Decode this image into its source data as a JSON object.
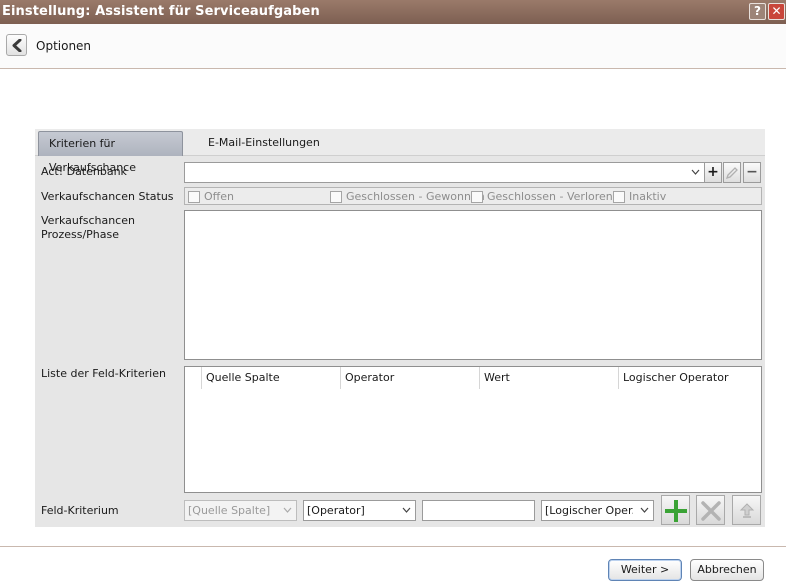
{
  "window": {
    "title": "Einstellung: Assistent für Serviceaufgaben",
    "help_label": "?",
    "close_label": "✕"
  },
  "options_bar": {
    "label": "Optionen"
  },
  "tabs": [
    {
      "label": "Kriterien für Verkaufschance",
      "active": true
    },
    {
      "label": "E-Mail-Einstellungen",
      "active": false
    }
  ],
  "form": {
    "database_label": "Act! Datenbank",
    "database_value": "",
    "status_label": "Verkaufschancen Status",
    "status_options": [
      {
        "label": "Offen",
        "checked": false
      },
      {
        "label": "Geschlossen - Gewonnen",
        "checked": false
      },
      {
        "label": "Geschlossen - Verloren",
        "checked": false
      },
      {
        "label": "Inaktiv",
        "checked": false
      }
    ],
    "process_label_line1": "Verkaufschancen",
    "process_label_line2": "Prozess/Phase",
    "criteria_list_label": "Liste der Feld-Kriterien",
    "criteria_columns": [
      "Quelle Spalte",
      "Operator",
      "Wert",
      "Logischer Operator"
    ],
    "criteria_rows": [],
    "field_criterion_label": "Feld-Kriterium",
    "source_column_value": "[Quelle Spalte]",
    "operator_value": "[Operator]",
    "value_input": "",
    "logical_operator_value": "[Logischer Oper..."
  },
  "buttons": {
    "add_symbol": "+",
    "remove_symbol": "−",
    "next": "Weiter >",
    "cancel": "Abbrechen"
  },
  "colors": {
    "titlebar": "#8a6b5d",
    "accent_green": "#3aa335",
    "close_red": "#c9463a"
  }
}
